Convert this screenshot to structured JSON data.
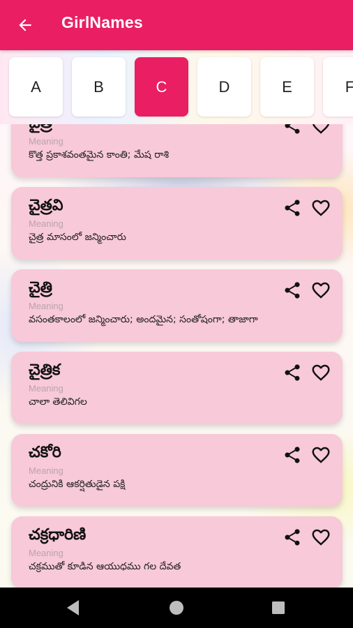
{
  "app": {
    "title": "GirlNames",
    "accent_color": "#e91e63",
    "back_icon": "arrow-left-icon"
  },
  "letters": {
    "items": [
      "A",
      "B",
      "C",
      "D",
      "E",
      "F"
    ],
    "selected": "C"
  },
  "cards": [
    {
      "name": "చైత్ర",
      "meaning_label": "Meaning",
      "meaning": "కొత్త ప్రకాశవంతమైన కాంతి; మేష రాశి"
    },
    {
      "name": "చైత్రవి",
      "meaning_label": "Meaning",
      "meaning": "చైత్ర మాసంలో జన్మించారు"
    },
    {
      "name": "చైత్రి",
      "meaning_label": "Meaning",
      "meaning": "వసంతకాలంలో జన్మించారు; అందమైన; సంతోషంగా; తాజాగా"
    },
    {
      "name": "చైత్రిక",
      "meaning_label": "Meaning",
      "meaning": "చాలా తెలివిగల"
    },
    {
      "name": "చకోరి",
      "meaning_label": "Meaning",
      "meaning": "చంద్రునికి ఆకర్షితుడైన పక్షి"
    },
    {
      "name": "చక్రధారిణి",
      "meaning_label": "Meaning",
      "meaning": "చక్రముతో కూడిన ఆయుధము గల దేవత"
    }
  ],
  "card_icons": {
    "share": "share-icon",
    "favorite": "heart-outline-icon"
  },
  "system_nav": {
    "back": "nav-back-icon",
    "home": "nav-home-icon",
    "recents": "nav-recents-icon"
  }
}
